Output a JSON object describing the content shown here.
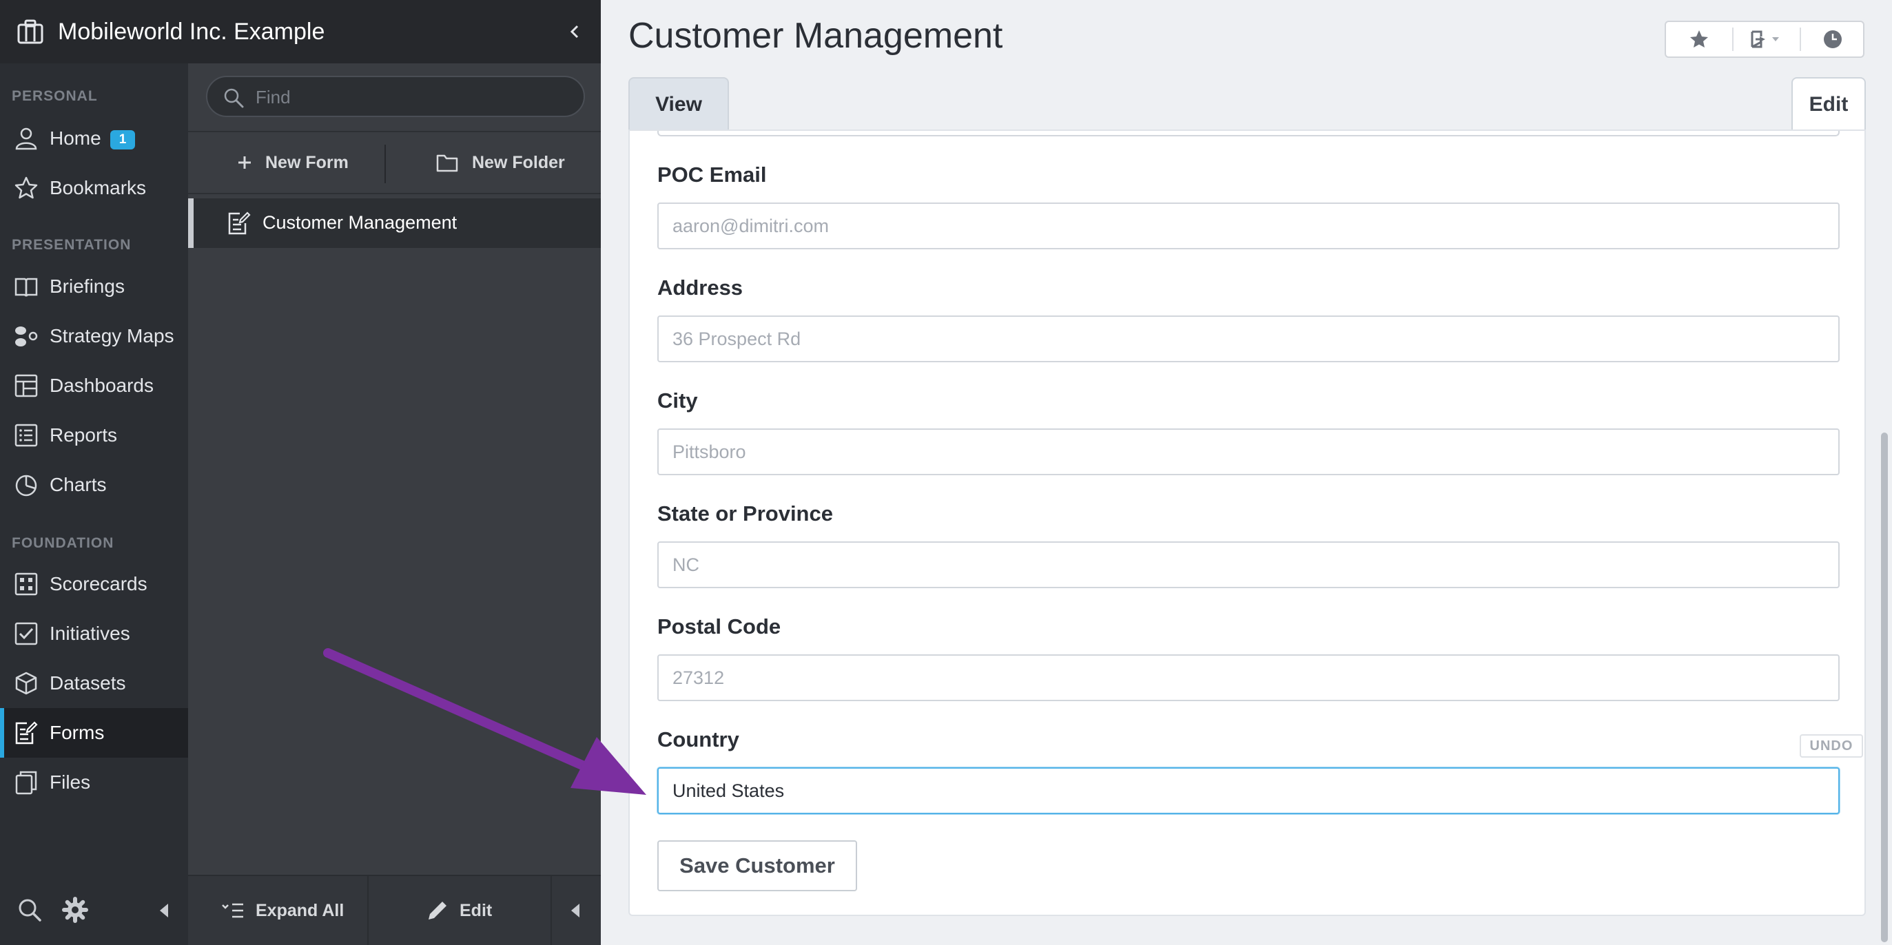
{
  "app": {
    "org_name": "Mobileworld Inc. Example"
  },
  "nav": {
    "sections": {
      "personal": "PERSONAL",
      "presentation": "PRESENTATION",
      "foundation": "FOUNDATION"
    },
    "items": [
      {
        "label": "Home",
        "icon": "user-icon",
        "badge": "1"
      },
      {
        "label": "Bookmarks",
        "icon": "star-icon"
      },
      {
        "label": "Briefings",
        "icon": "book-icon"
      },
      {
        "label": "Strategy Maps",
        "icon": "strategy-map-icon"
      },
      {
        "label": "Dashboards",
        "icon": "dashboard-icon"
      },
      {
        "label": "Reports",
        "icon": "list-icon"
      },
      {
        "label": "Charts",
        "icon": "pie-chart-icon"
      },
      {
        "label": "Scorecards",
        "icon": "scorecard-icon"
      },
      {
        "label": "Initiatives",
        "icon": "checkbox-icon"
      },
      {
        "label": "Datasets",
        "icon": "cube-icon"
      },
      {
        "label": "Forms",
        "icon": "form-icon",
        "active": true
      },
      {
        "label": "Files",
        "icon": "files-icon"
      }
    ]
  },
  "panel": {
    "find_placeholder": "Find",
    "new_form": "New Form",
    "new_folder": "New Folder",
    "selected_item": "Customer Management",
    "expand_all": "Expand All",
    "edit": "Edit"
  },
  "main": {
    "title": "Customer Management",
    "tabs": {
      "view": "View",
      "edit": "Edit"
    },
    "fields": {
      "poc_email": {
        "label": "POC Email",
        "placeholder": "aaron@dimitri.com"
      },
      "address": {
        "label": "Address",
        "placeholder": "36 Prospect Rd"
      },
      "city": {
        "label": "City",
        "placeholder": "Pittsboro"
      },
      "state": {
        "label": "State or Province",
        "placeholder": "NC"
      },
      "postal": {
        "label": "Postal Code",
        "placeholder": "27312"
      },
      "country": {
        "label": "Country",
        "value": "United States"
      }
    },
    "undo": "UNDO",
    "save_button": "Save Customer"
  },
  "colors": {
    "accent": "#2aa8e0",
    "annotation_arrow": "#7b2fa0"
  }
}
